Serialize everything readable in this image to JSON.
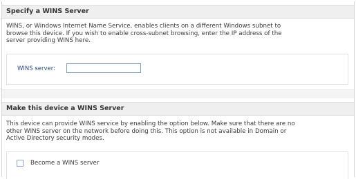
{
  "wins_section": {
    "title": "Specify a WINS Server",
    "description_lines": [
      "WINS, or Windows Internet Name Service, enables clients on a different Windows subnet to",
      "browse this device. If you wish to enable cross-subnet browsing, enter the IP address of the",
      "server providing WINS here."
    ],
    "field_label": "WINS server:",
    "field_value": ""
  },
  "make_server_section": {
    "title": "Make this device a WINS Server",
    "description_lines": [
      "This device can provide WINS service by enabling the option below. Make sure that there are no",
      "other WINS server on the network before doing this. This option is not available in Domain or",
      "Active Directory security modes."
    ],
    "checkbox_label": "Become a WINS server",
    "checkbox_checked": false
  }
}
